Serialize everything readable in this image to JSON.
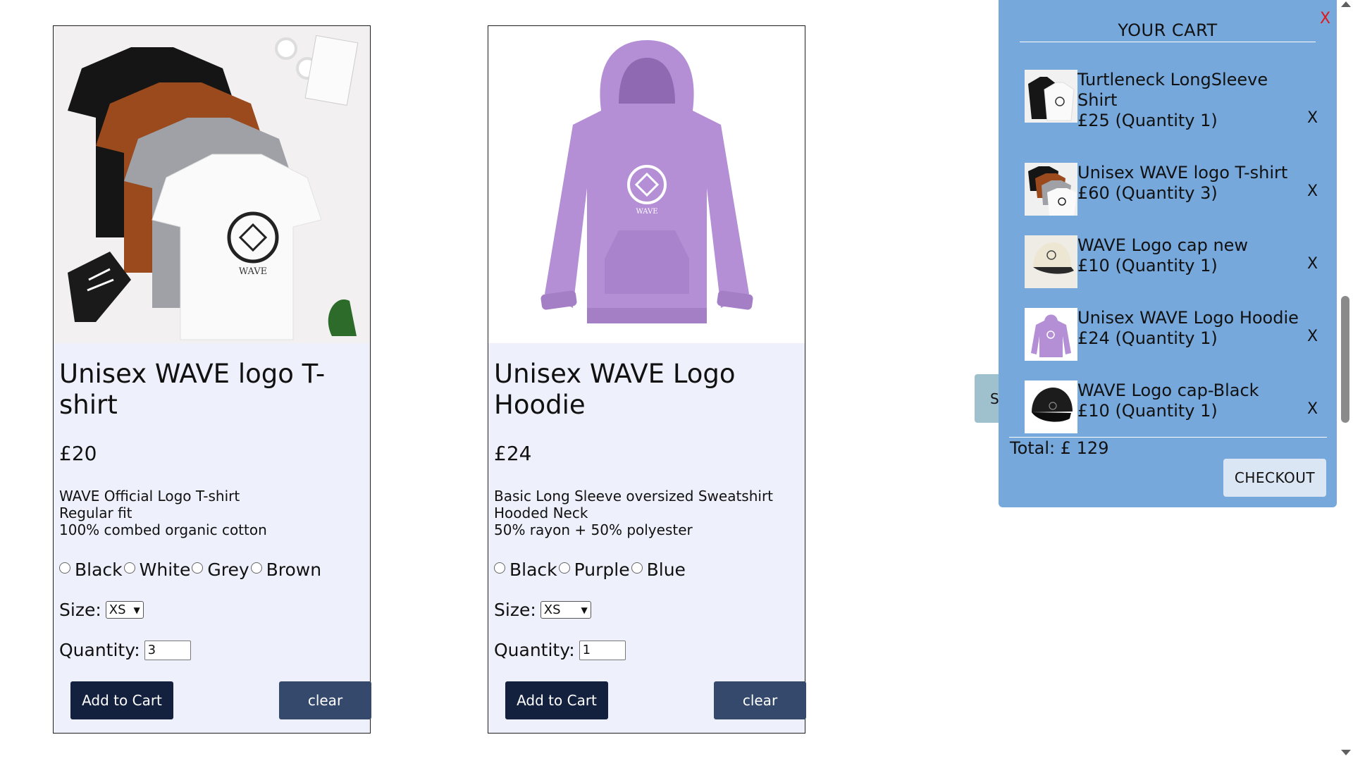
{
  "products": [
    {
      "name": "Unisex WAVE logo T-shirt",
      "price": "£20",
      "description": "WAVE Official Logo T-shirt\nRegular fit\n100% combed organic cotton",
      "colors": [
        "Black",
        "White",
        "Grey",
        "Brown"
      ],
      "size_label": "Size:",
      "size_value": "XS",
      "quantity_label": "Quantity:",
      "quantity_value": "3",
      "add_label": "Add to Cart",
      "clear_label": "clear",
      "image_icon": "tshirts-product-image",
      "logo_text": "WAVE"
    },
    {
      "name": "Unisex WAVE Logo Hoodie",
      "price": "£24",
      "description": "Basic Long Sleeve oversized Sweatshirt\nHooded Neck\n50% rayon + 50% polyester",
      "colors": [
        "Black",
        "Purple",
        "Blue"
      ],
      "size_label": "Size:",
      "size_value": "XS",
      "quantity_label": "Quantity:",
      "quantity_value": "1",
      "add_label": "Add to Cart",
      "clear_label": "clear",
      "image_icon": "hoodie-product-image",
      "logo_text": "WAVE"
    }
  ],
  "hidden_tab_label": "S",
  "cart": {
    "close_label": "X",
    "title": "YOUR CART",
    "items": [
      {
        "name": "Turtleneck LongSleeve Shirt",
        "price_qty": "£25 (Quantity 1)",
        "remove": "X",
        "thumb": "turtleneck-thumb"
      },
      {
        "name": "Unisex WAVE logo T-shirt",
        "price_qty": "£60 (Quantity 3)",
        "remove": "X",
        "thumb": "tshirt-thumb"
      },
      {
        "name": "WAVE Logo cap new",
        "price_qty": "£10 (Quantity 1)",
        "remove": "X",
        "thumb": "cream-cap-thumb"
      },
      {
        "name": "Unisex WAVE Logo Hoodie",
        "price_qty": "£24 (Quantity 1)",
        "remove": "X",
        "thumb": "hoodie-thumb"
      },
      {
        "name": "WAVE Logo cap-Black",
        "price_qty": "£10 (Quantity 1)",
        "remove": "X",
        "thumb": "black-cap-thumb"
      }
    ],
    "total": "Total: £ 129",
    "checkout_label": "CHECKOUT"
  },
  "colors": {
    "card_bg": "#eef0fb",
    "add_button": "#13213f",
    "clear_button": "#34496b",
    "cart_bg": "#76a8dc",
    "close_red": "#e01818",
    "hoodie_purple": "#b58fd6"
  }
}
